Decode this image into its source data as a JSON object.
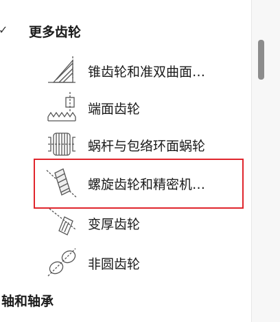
{
  "tree": {
    "groups": [
      {
        "label": "更多齿轮",
        "expanded": true,
        "items": [
          {
            "label": "锥齿轮和准双曲面…",
            "icon": "bevel-gear-icon"
          },
          {
            "label": "端面齿轮",
            "icon": "face-gear-icon"
          },
          {
            "label": "蜗杆与包络环面蜗轮",
            "icon": "worm-gear-icon"
          },
          {
            "label": "螺旋齿轮和精密机…",
            "icon": "helical-gear-icon",
            "highlighted": true
          },
          {
            "label": "变厚齿轮",
            "icon": "beveloid-gear-icon"
          },
          {
            "label": "非圆齿轮",
            "icon": "noncircular-gear-icon"
          }
        ]
      },
      {
        "label": "轴和轴承"
      }
    ]
  },
  "colors": {
    "highlight_border": "#e0242b",
    "icon_stroke": "#555555"
  }
}
